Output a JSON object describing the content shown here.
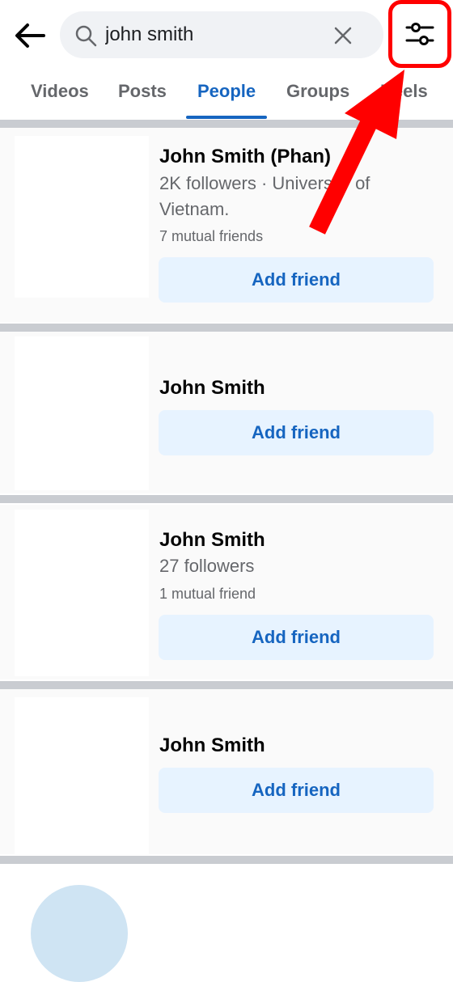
{
  "search": {
    "value": "john smith",
    "placeholder": "Search"
  },
  "tabs": [
    {
      "label": "Videos",
      "active": false
    },
    {
      "label": "Posts",
      "active": false
    },
    {
      "label": "People",
      "active": true
    },
    {
      "label": "Groups",
      "active": false
    },
    {
      "label": "Reels",
      "active": false
    }
  ],
  "results": [
    {
      "name": "John Smith (Phan)",
      "followers": "2K followers · University of Vietnam.",
      "mutual": "7 mutual friends",
      "button": "Add friend"
    },
    {
      "name": "John Smith",
      "button": "Add friend"
    },
    {
      "name": "John Smith",
      "followers": "27 followers",
      "mutual": "1 mutual friend",
      "button": "Add friend"
    },
    {
      "name": "John Smith",
      "button": "Add friend"
    }
  ],
  "icons": {
    "back": "arrow-left-icon",
    "search": "search-icon",
    "clear": "close-icon",
    "filter": "filter-sliders-icon"
  },
  "colors": {
    "accent": "#1665c0",
    "highlight": "#ff0000",
    "button_bg": "#e7f3ff"
  }
}
